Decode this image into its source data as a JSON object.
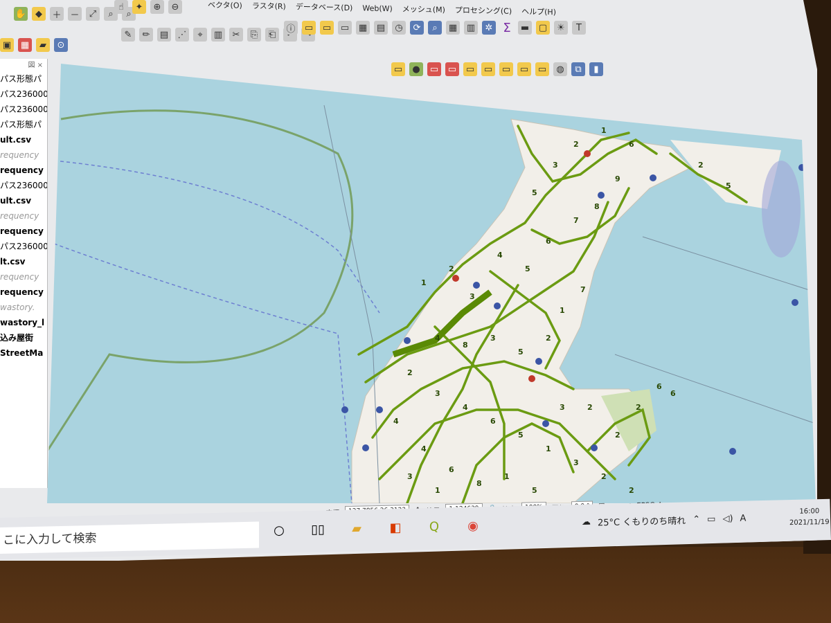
{
  "menu": [
    "ベクタ(O)",
    "ラスタ(R)",
    "データベース(D)",
    "Web(W)",
    "メッシュ(M)",
    "プロセシング(C)",
    "ヘルプ(H)"
  ],
  "layer_panel": {
    "header": "図 ×",
    "items": [
      {
        "label": "パス形態パ",
        "style": "normal"
      },
      {
        "label": "パス236000",
        "style": "normal"
      },
      {
        "label": "パス236000",
        "style": "normal"
      },
      {
        "label": "パス形態パ",
        "style": "normal"
      },
      {
        "label": "ult.csv",
        "style": "bold"
      },
      {
        "label": "requency",
        "style": "italic"
      },
      {
        "label": "requency",
        "style": "bold"
      },
      {
        "label": "パス236000",
        "style": "normal"
      },
      {
        "label": "ult.csv",
        "style": "bold"
      },
      {
        "label": "requency",
        "style": "italic"
      },
      {
        "label": "requency",
        "style": "bold"
      },
      {
        "label": "パス236000",
        "style": "normal"
      },
      {
        "label": "lt.csv",
        "style": "bold"
      },
      {
        "label": "requency",
        "style": "italic"
      },
      {
        "label": "requency",
        "style": "bold"
      },
      {
        "label": "wastory.",
        "style": "italic"
      },
      {
        "label": "wastory_l",
        "style": "bold"
      },
      {
        "label": "込み屋街 ",
        "style": "bold"
      },
      {
        "label": "StreetMa",
        "style": "bold"
      }
    ]
  },
  "statusbar": {
    "coord_label": "座標",
    "coord_value": "127.7856,26.3123",
    "scale_label": "縮尺",
    "scale_value": "1:124639",
    "magnifier_label": "拡大",
    "magnifier_value": "100%",
    "rotation_label": "回転",
    "rotation_value": "0.0 °",
    "render_label": "レンダ",
    "crs": "EPSG:4"
  },
  "taskbar": {
    "search_placeholder": "こに入力して検索",
    "weather": "25°C くもりのち晴れ",
    "ime": "A",
    "time": "16:00",
    "date": "2021/11/19"
  },
  "map_labels": [
    "1",
    "2",
    "3",
    "4",
    "5",
    "6",
    "7",
    "8",
    "9",
    "5",
    "3",
    "2",
    "1",
    "6",
    "4",
    "8",
    "3",
    "5",
    "2",
    "1",
    "7",
    "2",
    "3",
    "4",
    "6",
    "5",
    "1",
    "3",
    "2",
    "2",
    "4",
    "6",
    "8",
    "1",
    "5",
    "3",
    "2",
    "2",
    "2",
    "6",
    "6",
    "4",
    "3",
    "1",
    "2",
    "5"
  ],
  "colors": {
    "water": "#aad3df",
    "land": "#f2efe9",
    "route": "#6b9b12",
    "stop": "#3b55a5"
  }
}
